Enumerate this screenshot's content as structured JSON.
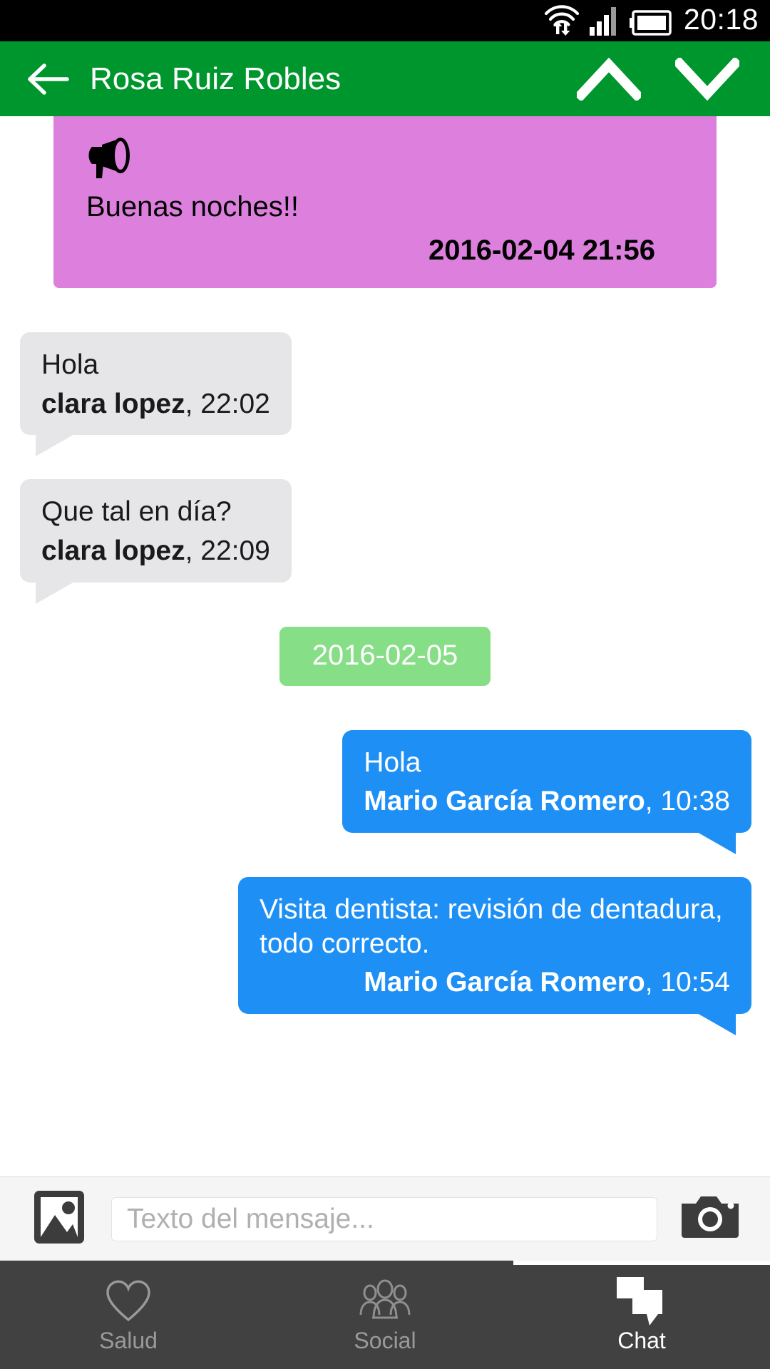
{
  "statusbar": {
    "time": "20:18",
    "icons": [
      "wifi-icon",
      "signal-icon",
      "battery-icon"
    ]
  },
  "appbar": {
    "title": "Rosa Ruiz Robles",
    "back_icon": "arrow-left-icon",
    "prev_icon": "chevron-up-icon",
    "next_icon": "chevron-down-icon"
  },
  "thread": {
    "announcement": {
      "icon": "megaphone-icon",
      "text": "Buenas noches!!",
      "timestamp": "2016-02-04 21:56",
      "color": "#dd7fdd"
    },
    "messages": [
      {
        "type": "incoming",
        "text": "Hola",
        "sender": "clara lopez",
        "time": ", 22:02",
        "color": "#e6e6e9"
      },
      {
        "type": "incoming",
        "text": "Que tal en día?",
        "sender": "clara lopez",
        "time": ", 22:09",
        "color": "#e6e6e9"
      },
      {
        "type": "divider",
        "text": "2016-02-05",
        "color": "#86de86"
      },
      {
        "type": "outgoing",
        "text": "Hola",
        "sender": "Mario García Romero",
        "time": ", 10:38",
        "color": "#1e90f5"
      },
      {
        "type": "outgoing",
        "text": "Visita dentista: revisión de dentadura, todo correcto.",
        "sender": "Mario García Romero",
        "time": ", 10:54",
        "color": "#1e90f5"
      }
    ]
  },
  "composer": {
    "gallery_icon": "image-icon",
    "camera_icon": "camera-icon",
    "placeholder": "Texto del mensaje...",
    "value": ""
  },
  "bottomnav": {
    "items": [
      {
        "label": "Salud",
        "icon": "heart-icon",
        "active": false
      },
      {
        "label": "Social",
        "icon": "people-icon",
        "active": false
      },
      {
        "label": "Chat",
        "icon": "chat-bubbles-icon",
        "active": true
      }
    ],
    "accent": "#ffffff",
    "background": "#414141"
  }
}
